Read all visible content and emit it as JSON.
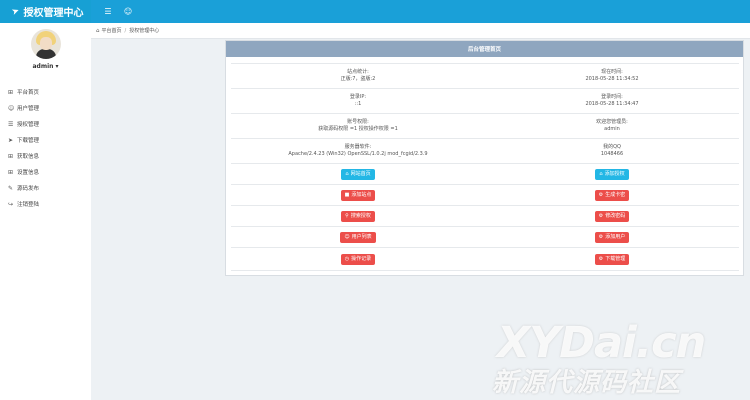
{
  "header": {
    "brand_title": "授权管理中心",
    "icons": [
      "menu-icon",
      "user-icon"
    ]
  },
  "colors": {
    "topbar": "#1aa0d8",
    "panel_header": "#8fa6bf",
    "btn_blue": "#23b7e5",
    "btn_red": "#ec4e4a"
  },
  "sidebar": {
    "user": "admin",
    "items": [
      {
        "label": "平台首页",
        "icon": "grid-icon"
      },
      {
        "label": "用户管理",
        "icon": "user-icon"
      },
      {
        "label": "授权管理",
        "icon": "layers-icon"
      },
      {
        "label": "下载管理",
        "icon": "rocket-icon"
      },
      {
        "label": "获取信息",
        "icon": "grid-icon"
      },
      {
        "label": "设置信息",
        "icon": "grid-icon"
      },
      {
        "label": "源码发布",
        "icon": "edit-icon"
      },
      {
        "label": "注销登陆",
        "icon": "logout-icon"
      }
    ]
  },
  "breadcrumb": {
    "home": "平台首页",
    "current": "授权管理中心"
  },
  "panel": {
    "title": "后台管理首页",
    "rows": [
      {
        "left_label": "站点统计:",
        "left_value": "正版:7，盗版:2",
        "right_label": "现在时间:",
        "right_value": "2018-05-28 11:34:52"
      },
      {
        "left_label": "登录IP:",
        "left_value": "::1",
        "right_label": "登录时间:",
        "right_value": "2018-05-28 11:34:47"
      },
      {
        "left_label": "账号权限:",
        "left_value": "获取源码权限 =1 授权操作权限 =1",
        "right_label": "欢迎您管理员:",
        "right_value": "admin"
      },
      {
        "left_label": "服务器软件:",
        "left_value": "Apache/2.4.23 (Win32) OpenSSL/1.0.2j mod_fcgid/2.3.9",
        "right_label": "我的QQ",
        "right_value": "1048466"
      }
    ],
    "buttons": [
      {
        "left": "网站首页",
        "right": "添加授权"
      },
      {
        "left": "添加站点",
        "right": "生成卡密"
      },
      {
        "left": "搜索授权",
        "right": "修改密码"
      },
      {
        "left": "用户列表",
        "right": "添加用户"
      },
      {
        "left": "操作记录",
        "right": "下载管理"
      }
    ]
  },
  "watermark": {
    "line1": "XYDai.cn",
    "line2": "新源代源码社区"
  }
}
